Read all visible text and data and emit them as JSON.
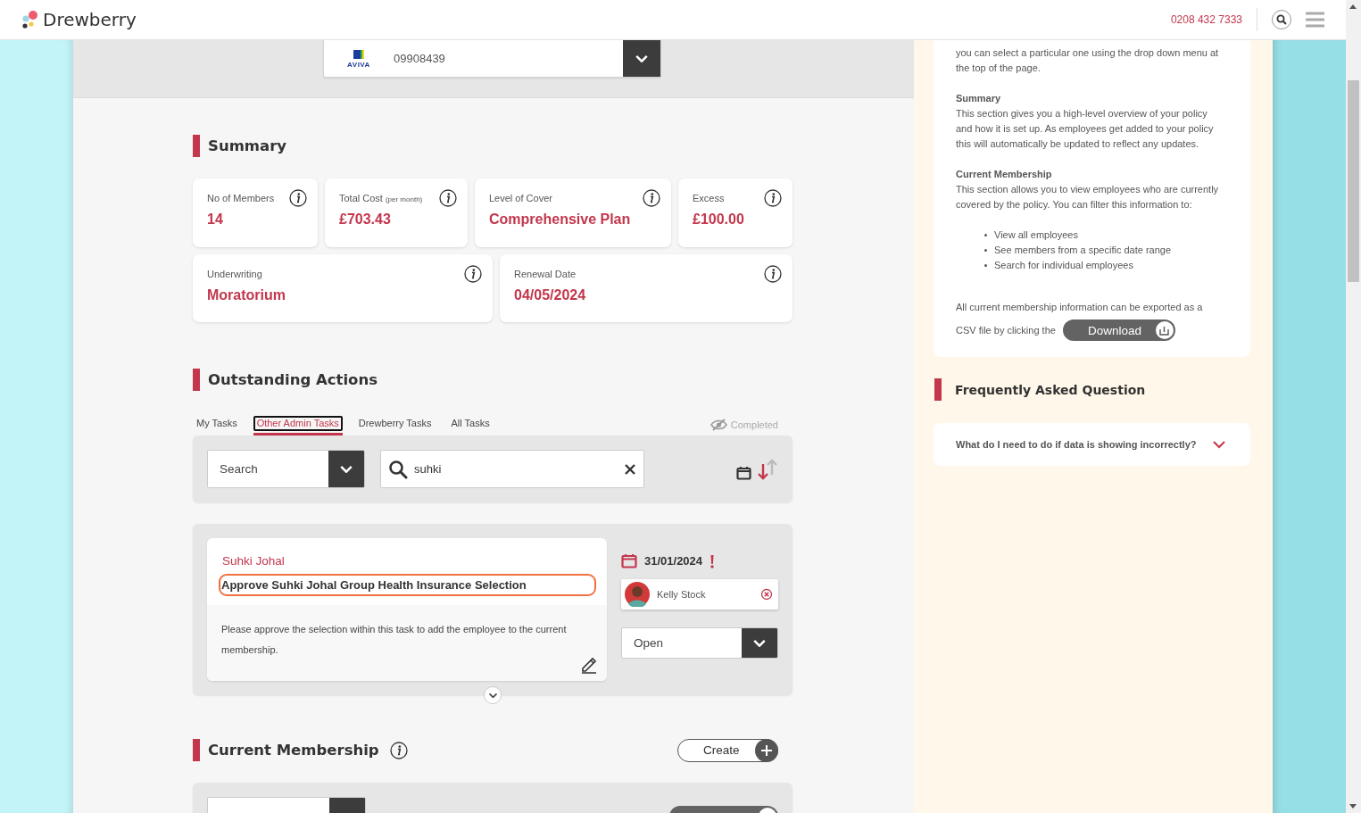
{
  "header": {
    "logo": "Drewberry",
    "phone": "0208 432 7333"
  },
  "policy_select": {
    "insurer": "AVIVA",
    "value": "09908439"
  },
  "summary": {
    "title": "Summary",
    "cards": [
      {
        "label": "No of Members",
        "value": "14"
      },
      {
        "label": "Total Cost",
        "note": "(per month)",
        "value": "£703.43"
      },
      {
        "label": "Level of Cover",
        "value": "Comprehensive Plan"
      },
      {
        "label": "Excess",
        "value": "£100.00"
      },
      {
        "label": "Underwriting",
        "value": "Moratorium"
      },
      {
        "label": "Renewal Date",
        "value": "04/05/2024"
      }
    ]
  },
  "outstanding": {
    "title": "Outstanding Actions",
    "tabs": [
      {
        "label": "My Tasks",
        "selected": false
      },
      {
        "label": "Other Admin Tasks",
        "selected": true
      },
      {
        "label": "Drewberry Tasks",
        "selected": false
      },
      {
        "label": "All Tasks",
        "selected": false
      }
    ],
    "completed_toggle": {
      "label": "Completed"
    },
    "filter": {
      "value": "Search"
    },
    "search": {
      "value": "suhki"
    },
    "task": {
      "person": "Suhki Johal",
      "title": "Approve Suhki Johal Group Health Insurance Selection",
      "description": "Please approve the selection within this task to add the employee to the current membership.",
      "due": "31/01/2024",
      "overdue": true,
      "assignee": "Kelly Stock",
      "status": "Open"
    }
  },
  "membership": {
    "title": "Current Membership",
    "create": "Create"
  },
  "help": {
    "intro": "you can select a particular one using the drop down menu at the top of the page.",
    "sections": [
      {
        "heading": "Summary",
        "text": "This section gives you a high-level overview of your policy and how it is set up. As employees get added to your policy this will automatically be updated to reflect any updates."
      },
      {
        "heading": "Current Membership",
        "text": "This section allows you to view employees who are currently covered by the policy. You can filter this information to:"
      }
    ],
    "bullets": [
      "View all employees",
      "See members from a specific date range",
      "Search for individual employees"
    ],
    "export_lines": [
      "All current membership information can be exported as a",
      "CSV file by clicking the"
    ],
    "download": "Download"
  },
  "faq": {
    "title": "Frequently Asked Question",
    "items": [
      {
        "question": "What do I need to do if data is showing incorrectly?",
        "expanded": false
      }
    ]
  }
}
